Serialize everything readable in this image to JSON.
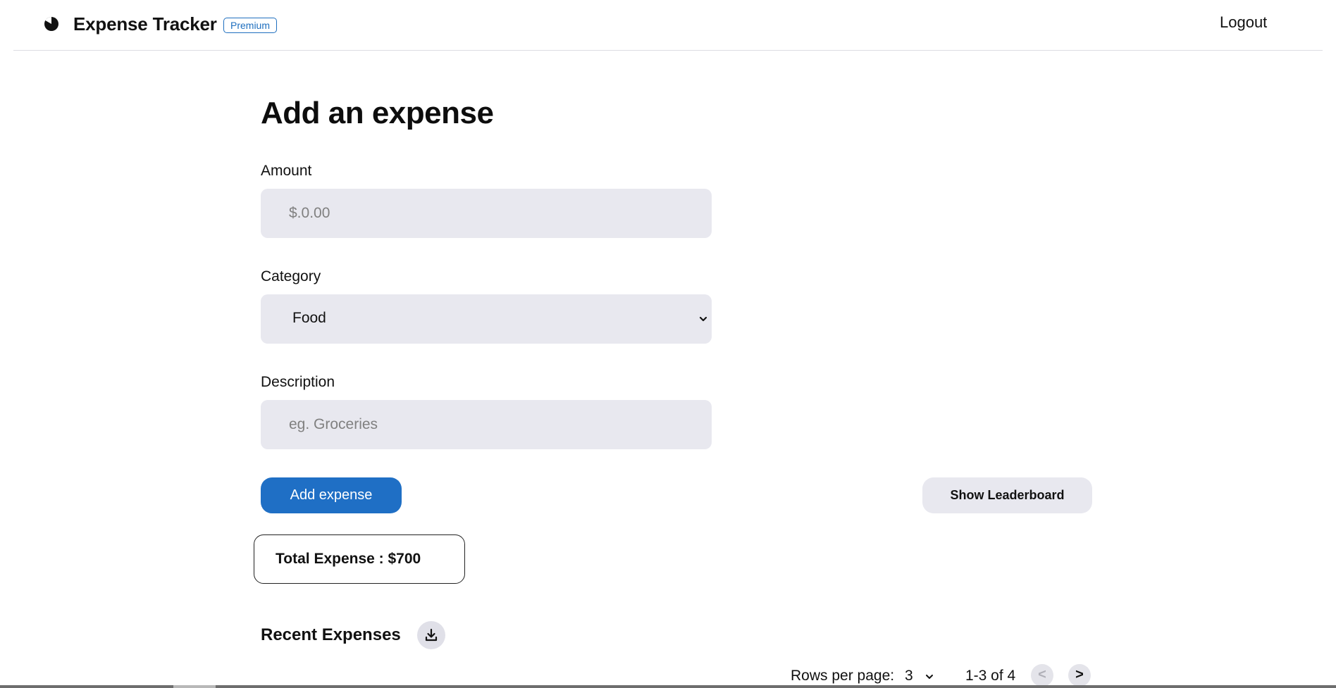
{
  "header": {
    "logo_icon": "pie-logo-icon",
    "app_title": "Expense Tracker",
    "badge": "Premium",
    "logout_label": "Logout"
  },
  "form": {
    "title": "Add an expense",
    "amount": {
      "label": "Amount",
      "placeholder": "$.0.00",
      "value": ""
    },
    "category": {
      "label": "Category",
      "selected": "Food",
      "icon": "chevron-down-icon"
    },
    "description": {
      "label": "Description",
      "placeholder": "eg. Groceries",
      "value": ""
    },
    "submit_label": "Add expense",
    "leaderboard_label": "Show Leaderboard"
  },
  "summary": {
    "total_text": "Total Expense : $700"
  },
  "recent": {
    "title": "Recent Expenses",
    "download_icon": "download-icon"
  },
  "pagination": {
    "rows_label": "Rows per page:",
    "rows_value": "3",
    "range": "1-3 of 4",
    "prev_label": "<",
    "next_label": ">"
  },
  "colors": {
    "primary": "#1f6fc5",
    "input_bg": "#e8e8ef",
    "text": "#111111"
  }
}
